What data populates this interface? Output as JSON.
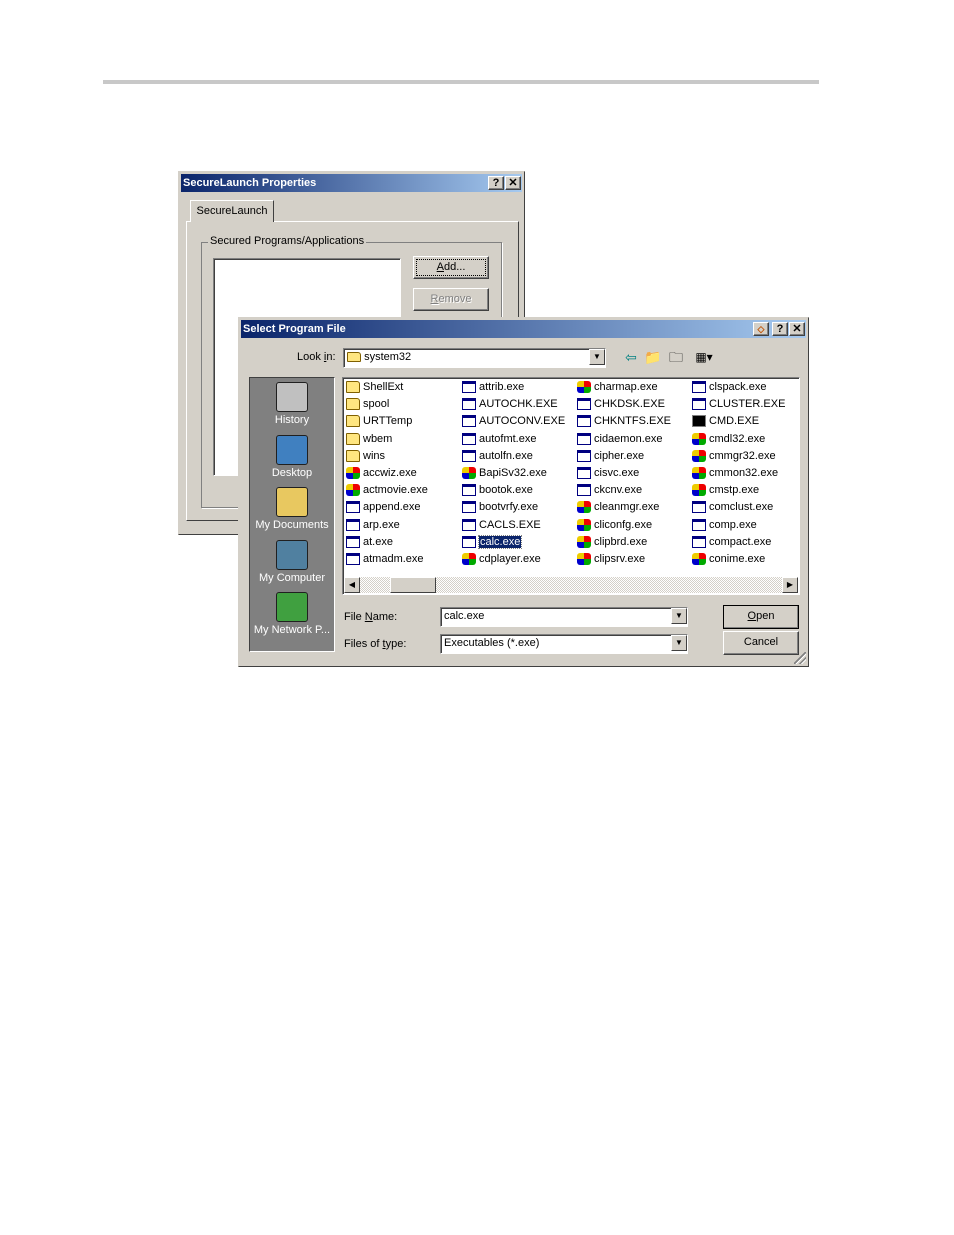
{
  "properties_window": {
    "title": "SecureLaunch Properties",
    "help_button": "?",
    "close_button": "✕",
    "tab_label": "SecureLaunch",
    "group_label": "Secured Programs/Applications",
    "add_button_prefix": "",
    "add_button_accel": "A",
    "add_button_rest": "dd...",
    "remove_button_accel": "R",
    "remove_button_rest": "emove"
  },
  "dialog": {
    "title": "Select Program File",
    "help_button": "?",
    "close_button": "✕",
    "look_in_label_a": "Look ",
    "look_in_label_accel": "i",
    "look_in_label_b": "n:",
    "look_in_value": "system32",
    "places": [
      {
        "label": "History",
        "icon": "history-icon"
      },
      {
        "label": "Desktop",
        "icon": "desktop-icon"
      },
      {
        "label": "My Documents",
        "icon": "my-documents-icon"
      },
      {
        "label": "My Computer",
        "icon": "my-computer-icon"
      },
      {
        "label": "My Network P...",
        "icon": "my-network-places-icon"
      }
    ],
    "columns": [
      [
        {
          "name": "ShellExt",
          "icon": "folder"
        },
        {
          "name": "spool",
          "icon": "folder"
        },
        {
          "name": "URTTemp",
          "icon": "folder"
        },
        {
          "name": "wbem",
          "icon": "folder"
        },
        {
          "name": "wins",
          "icon": "folder"
        },
        {
          "name": "accwiz.exe",
          "icon": "color"
        },
        {
          "name": "actmovie.exe",
          "icon": "color"
        },
        {
          "name": "append.exe",
          "icon": "exe"
        },
        {
          "name": "arp.exe",
          "icon": "exe"
        },
        {
          "name": "at.exe",
          "icon": "exe"
        },
        {
          "name": "atmadm.exe",
          "icon": "exe"
        }
      ],
      [
        {
          "name": "attrib.exe",
          "icon": "exe"
        },
        {
          "name": "AUTOCHK.EXE",
          "icon": "exe"
        },
        {
          "name": "AUTOCONV.EXE",
          "icon": "exe"
        },
        {
          "name": "autofmt.exe",
          "icon": "exe"
        },
        {
          "name": "autolfn.exe",
          "icon": "exe"
        },
        {
          "name": "BapiSv32.exe",
          "icon": "color"
        },
        {
          "name": "bootok.exe",
          "icon": "exe"
        },
        {
          "name": "bootvrfy.exe",
          "icon": "exe"
        },
        {
          "name": "CACLS.EXE",
          "icon": "exe"
        },
        {
          "name": "calc.exe",
          "icon": "exe",
          "selected": true
        },
        {
          "name": "cdplayer.exe",
          "icon": "color"
        }
      ],
      [
        {
          "name": "charmap.exe",
          "icon": "color"
        },
        {
          "name": "CHKDSK.EXE",
          "icon": "exe"
        },
        {
          "name": "CHKNTFS.EXE",
          "icon": "exe"
        },
        {
          "name": "cidaemon.exe",
          "icon": "exe"
        },
        {
          "name": "cipher.exe",
          "icon": "exe"
        },
        {
          "name": "cisvc.exe",
          "icon": "exe"
        },
        {
          "name": "ckcnv.exe",
          "icon": "exe"
        },
        {
          "name": "cleanmgr.exe",
          "icon": "color"
        },
        {
          "name": "cliconfg.exe",
          "icon": "color"
        },
        {
          "name": "clipbrd.exe",
          "icon": "color"
        },
        {
          "name": "clipsrv.exe",
          "icon": "color"
        }
      ],
      [
        {
          "name": "clspack.exe",
          "icon": "exe"
        },
        {
          "name": "CLUSTER.EXE",
          "icon": "exe"
        },
        {
          "name": "CMD.EXE",
          "icon": "cmd"
        },
        {
          "name": "cmdl32.exe",
          "icon": "color"
        },
        {
          "name": "cmmgr32.exe",
          "icon": "color"
        },
        {
          "name": "cmmon32.exe",
          "icon": "color"
        },
        {
          "name": "cmstp.exe",
          "icon": "color"
        },
        {
          "name": "comclust.exe",
          "icon": "exe"
        },
        {
          "name": "comp.exe",
          "icon": "exe"
        },
        {
          "name": "compact.exe",
          "icon": "exe"
        },
        {
          "name": "conime.exe",
          "icon": "color"
        }
      ]
    ],
    "file_name_label_accel": "N",
    "file_name_label_a": "File ",
    "file_name_label_b": "ame:",
    "file_name_value": "calc.exe",
    "files_of_type_label_a": "Files of ",
    "files_of_type_label_accel": "t",
    "files_of_type_label_b": "ype:",
    "files_of_type_value": "Executables (*.exe)",
    "open_accel": "O",
    "open_rest": "pen",
    "cancel_label": "Cancel"
  }
}
